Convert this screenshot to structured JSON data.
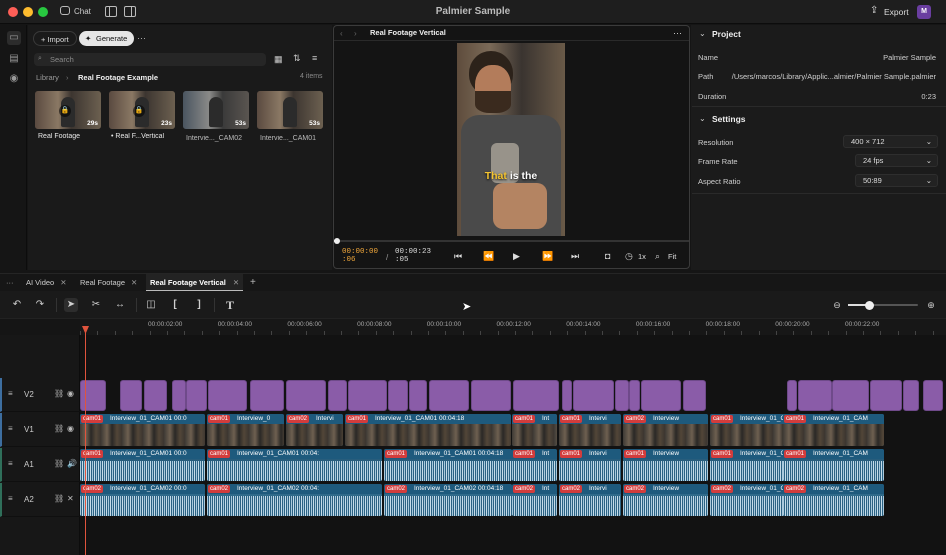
{
  "window": {
    "title": "Palmier Sample",
    "chat_label": "Chat",
    "export_label": "Export",
    "avatar_letter": "M"
  },
  "library": {
    "import_label": "+ Import",
    "generate_label": "Generate",
    "search_placeholder": "Search",
    "breadcrumb_root": "Library",
    "breadcrumb_current": "Real Footage Example",
    "item_count": "4 items",
    "items": [
      {
        "name": "Real Footage",
        "duration": "29s",
        "locked": true
      },
      {
        "name": "• Real F...Vertical",
        "duration": "23s",
        "locked": true
      },
      {
        "name": "Intervie..._CAM02",
        "duration": "53s",
        "locked": false
      },
      {
        "name": "Intervie..._CAM01",
        "duration": "53s",
        "locked": false
      }
    ]
  },
  "preview": {
    "tab": "Real Footage Vertical",
    "caption_highlight": "That",
    "caption_rest": " is the",
    "timecode_current_a": "00:00:00",
    "timecode_current_b": ":06",
    "timecode_sep": "/",
    "timecode_total_a": "00:00:23",
    "timecode_total_b": ":05",
    "speed": "1x",
    "fit": "Fit",
    "progress": 0.01
  },
  "project": {
    "section_title": "Project",
    "rows": [
      {
        "label": "Name",
        "value": "Palmier Sample"
      },
      {
        "label": "Path",
        "value": "/Users/marcos/Library/Applic...almier/Palmier Sample.palmier"
      },
      {
        "label": "Duration",
        "value": "0:23"
      }
    ],
    "settings_title": "Settings",
    "settings": [
      {
        "label": "Resolution",
        "value": "400 × 712"
      },
      {
        "label": "Frame Rate",
        "value": "24 fps"
      },
      {
        "label": "Aspect Ratio",
        "value": "50:89"
      }
    ]
  },
  "tabs": [
    {
      "label": "AI Video"
    },
    {
      "label": "Real Footage"
    },
    {
      "label": "Real Footage Vertical",
      "active": true
    }
  ],
  "ruler": {
    "labels": [
      "00:00:02:00",
      "00:00:04:00",
      "00:00:06:00",
      "00:00:08:00",
      "00:00:10:00",
      "00:00:12:00",
      "00:00:14:00",
      "00:00:16:00",
      "00:00:18:00",
      "00:00:20:00",
      "00:00:22:00"
    ]
  },
  "tracks": {
    "labels": [
      "V2",
      "V1",
      "A1",
      "A2"
    ]
  },
  "clips": {
    "v1": [
      {
        "tag": "cam01",
        "text": "Interview_01_CAM01 00:0"
      },
      {
        "tag": "cam01",
        "text": "Interview_0"
      },
      {
        "tag": "cam02",
        "text": "Intervi"
      },
      {
        "tag": "cam01",
        "text": "Interview_01_CAM01 00:04:18"
      },
      {
        "tag": "cam01",
        "text": "Int"
      },
      {
        "tag": "cam01",
        "text": "Intervi"
      },
      {
        "tag": "cam02",
        "text": "Interview"
      },
      {
        "tag": "cam01",
        "text": "Interview_01_C"
      },
      {
        "tag": "cam01",
        "text": "Interview_01_CAM"
      }
    ],
    "a1": [
      {
        "tag": "cam01",
        "text": "Interview_01_CAM01 00:0"
      },
      {
        "tag": "cam01",
        "text": "Interview_01_CAM01 00:04:"
      },
      {
        "tag": "cam01",
        "text": "Interview_01_CAM01 00:04:18"
      },
      {
        "tag": "cam01",
        "text": "Int"
      },
      {
        "tag": "cam01",
        "text": "Intervi"
      },
      {
        "tag": "cam01",
        "text": "Interview"
      },
      {
        "tag": "cam01",
        "text": "Interview_01_C"
      },
      {
        "tag": "cam01",
        "text": "Interview_01_CAM"
      }
    ],
    "a2": [
      {
        "tag": "cam02",
        "text": "Interview_01_CAM02 00:0"
      },
      {
        "tag": "cam02",
        "text": "Interview_01_CAM02 00:04:"
      },
      {
        "tag": "cam02",
        "text": "Interview_01_CAM02 00:04:18"
      },
      {
        "tag": "cam02",
        "text": "Int"
      },
      {
        "tag": "cam02",
        "text": "Intervi"
      },
      {
        "tag": "cam02",
        "text": "Interview"
      },
      {
        "tag": "cam02",
        "text": "Interview_01_C"
      },
      {
        "tag": "cam02",
        "text": "Interview_01_CAM"
      }
    ]
  },
  "colors": {
    "accent": "#e0543d",
    "video_clip": "#8a5ca8",
    "audio_clip": "#1e5a7d",
    "cam_tag": "#d23c3c",
    "avatar": "#6a3ea0"
  }
}
